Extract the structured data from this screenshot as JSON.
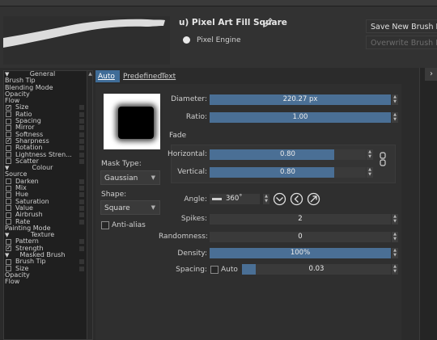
{
  "header": {
    "preset_title": "u) Pixel Art Fill Square",
    "engine": "Pixel Engine",
    "save_new_label": "Save New Brush Preset",
    "overwrite_label": "Overwrite Brush Preset",
    "edit_icon": "pencil-icon"
  },
  "options": [
    {
      "type": "category",
      "label": "General"
    },
    {
      "type": "plain",
      "label": "Brush Tip"
    },
    {
      "type": "plain",
      "label": "Blending Mode"
    },
    {
      "type": "plain",
      "label": "Opacity"
    },
    {
      "type": "plain",
      "label": "Flow"
    },
    {
      "type": "check",
      "label": "Size",
      "checked": true
    },
    {
      "type": "check",
      "label": "Ratio",
      "checked": false
    },
    {
      "type": "check",
      "label": "Spacing",
      "checked": false
    },
    {
      "type": "check",
      "label": "Mirror",
      "checked": false
    },
    {
      "type": "check",
      "label": "Softness",
      "checked": false
    },
    {
      "type": "check",
      "label": "Sharpness",
      "checked": true
    },
    {
      "type": "check",
      "label": "Rotation",
      "checked": false
    },
    {
      "type": "check",
      "label": "Lightness Stren...",
      "checked": false
    },
    {
      "type": "check",
      "label": "Scatter",
      "checked": false
    },
    {
      "type": "category",
      "label": "Colour"
    },
    {
      "type": "plain",
      "label": "Source"
    },
    {
      "type": "check",
      "label": "Darken",
      "checked": false
    },
    {
      "type": "check",
      "label": "Mix",
      "checked": false
    },
    {
      "type": "check",
      "label": "Hue",
      "checked": false
    },
    {
      "type": "check",
      "label": "Saturation",
      "checked": false
    },
    {
      "type": "check",
      "label": "Value",
      "checked": false
    },
    {
      "type": "check",
      "label": "Airbrush",
      "checked": false
    },
    {
      "type": "check",
      "label": "Rate",
      "checked": false
    },
    {
      "type": "plain",
      "label": "Painting Mode"
    },
    {
      "type": "category",
      "label": "Texture"
    },
    {
      "type": "check",
      "label": "Pattern",
      "checked": false
    },
    {
      "type": "check",
      "label": "Strength",
      "checked": true
    },
    {
      "type": "category",
      "label": "Masked Brush"
    },
    {
      "type": "check",
      "label": "Brush Tip",
      "checked": false
    },
    {
      "type": "check",
      "label": "Size",
      "checked": false
    },
    {
      "type": "plain",
      "label": "Opacity"
    },
    {
      "type": "plain",
      "label": "Flow"
    }
  ],
  "tabs": [
    {
      "label": "Auto",
      "active": true
    },
    {
      "label": "Predefined",
      "active": false
    },
    {
      "label": "Text",
      "active": false
    }
  ],
  "mask": {
    "mask_type_label": "Mask Type:",
    "mask_type_value": "Gaussian",
    "shape_label": "Shape:",
    "shape_value": "Square",
    "antialias_label": "Anti-alias",
    "antialias_checked": false
  },
  "params": {
    "diameter_label": "Diameter:",
    "diameter_value": "220.27 px",
    "diameter_fraction": 1.0,
    "ratio_label": "Ratio:",
    "ratio_value": "1.00",
    "ratio_fraction": 1.0,
    "fade_label": "Fade",
    "horizontal_label": "Horizontal:",
    "horizontal_value": "0.80",
    "horizontal_fraction": 0.8,
    "vertical_label": "Vertical:",
    "vertical_value": "0.80",
    "vertical_fraction": 0.8,
    "angle_label": "Angle:",
    "angle_value": "360˚",
    "spikes_label": "Spikes:",
    "spikes_value": "2",
    "spikes_fraction": 0.0,
    "randomness_label": "Randomness:",
    "randomness_value": "0",
    "randomness_fraction": 0.0,
    "density_label": "Density:",
    "density_value": "100%",
    "density_fraction": 1.0,
    "spacing_label": "Spacing:",
    "spacing_auto_label": "Auto",
    "spacing_auto_checked": false,
    "spacing_value": "0.03",
    "spacing_fraction": 0.09
  }
}
